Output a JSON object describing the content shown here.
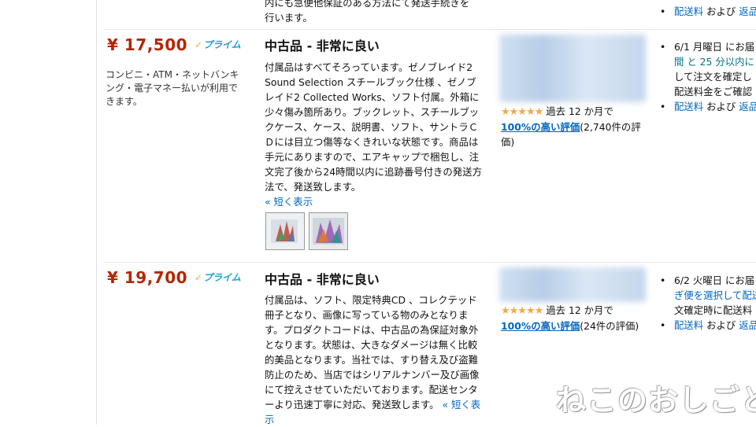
{
  "top_row": {
    "desc_partial": "内にも急便他保証のある方法にて発送手続きを",
    "desc_partial_2": "行います。",
    "delivery_link": "配送料",
    "delivery_and": "および",
    "delivery_cut": "返品"
  },
  "offers": [
    {
      "price": "¥ 17,500",
      "prime_label": "プライム",
      "payment_note": "コンビニ・ATM・ネットバンキング・電子マネー払いが利用できます。",
      "condition": "中古品 - 非常に良い",
      "description": "付属品はすべてそろっています。ゼノブレイド2 Sound Selection スチールブック仕様 、ゼノブレイド2 Collected Works、ソフト付属。外箱に少々傷み箇所あり。ブックレット、スチールブックケース、ケース、説明書、ソフト、サントラＣＤには目立つ傷等なくきれいな状態です。商品は手元にありますので、エアキャップで梱包し、注文完了後から24時間以内に追跡番号付きの発送方法で、発送致します。",
      "collapse_prefix": "« ",
      "collapse_link": "短く表示",
      "stars": "★★★★★",
      "rating_period": "過去 12 か月で",
      "rating_link": "100%の高い評価",
      "rating_count": "(2,740件の評価)",
      "delivery_lines": [
        "6/1 月曜日 にお届",
        "間 と 25 分以内に",
        "して注文を確定し",
        "配送料金をご確認"
      ],
      "delivery_link": "配送料",
      "delivery_and": "および",
      "delivery_cut": "返品"
    },
    {
      "price": "¥ 19,700",
      "prime_label": "プライム",
      "condition": "中古品 - 非常に良い",
      "description": "付属品は、ソフト、限定特典CD 、コレクテッド冊子となり、画像に写っている物のみとなります。プロダクトコードは、中古品の為保証対象外となります。状態は、大きなダメージは無く比較的美品となります。当社では、すり替え及び盗難防止のため、当店ではシリアルナンバー及び画像にて控えさせていただいております。配送センターより迅速丁寧に対応、発送致します。",
      "collapse_prefix": "« ",
      "collapse_link": "短く表示",
      "stars": "★★★★★",
      "rating_period": "過去 12 か月で",
      "rating_link": "100%の高い評価",
      "rating_count": "(24件の評価)",
      "delivery_lines": [
        "6/2 火曜日 にお届",
        "ぎ便を選択して配送",
        "文確定時に配送料"
      ],
      "delivery_link": "配送料",
      "delivery_and": "および",
      "delivery_cut": "返品"
    }
  ],
  "watermark": "ねこのおしごと",
  "colors": {
    "price": "#b12704",
    "link": "#0066c0",
    "star": "#f3a847",
    "prime": "#1ba0d8"
  }
}
